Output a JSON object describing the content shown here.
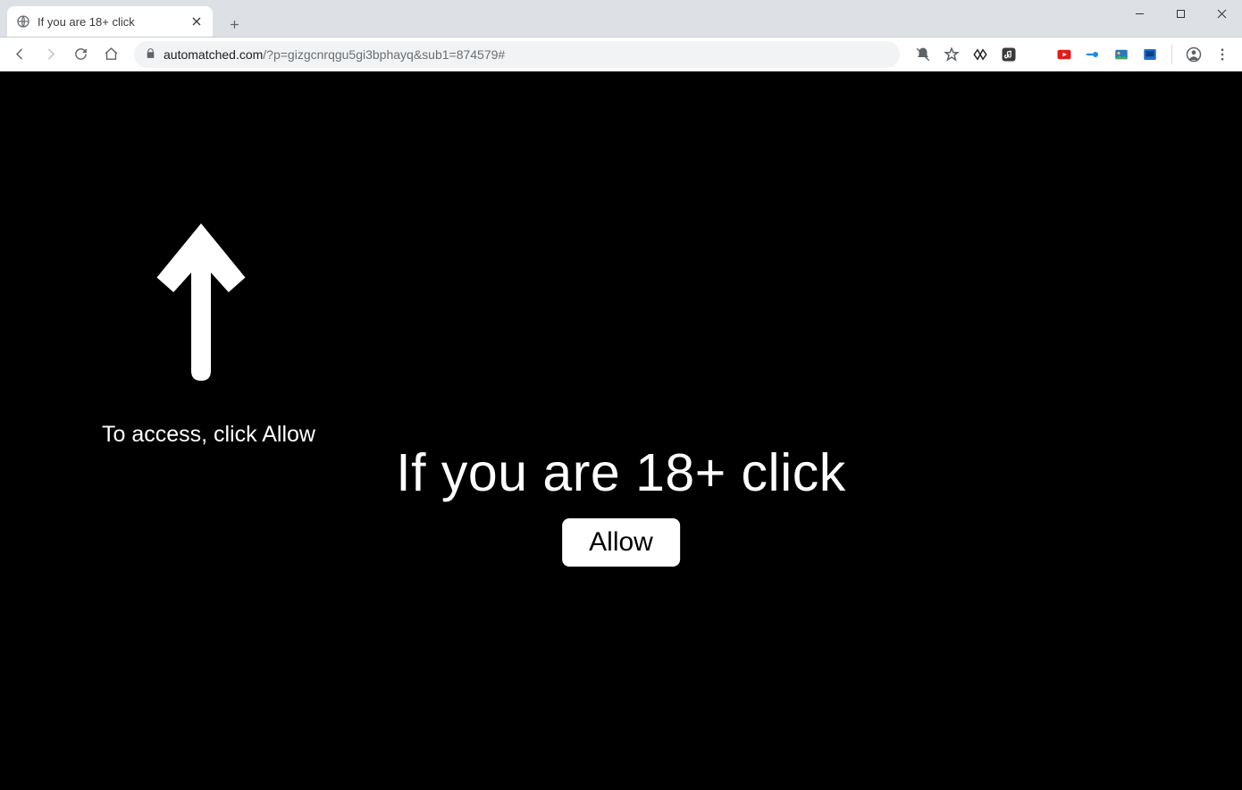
{
  "window": {
    "tab_title": "If you are 18+ click"
  },
  "toolbar": {
    "url_domain": "automatched.com",
    "url_path": "/?p=gizgcnrqgu5gi3bphayq&sub1=874579#"
  },
  "page": {
    "access_text": "To access, click Allow",
    "headline": "If you are 18+ click",
    "allow_label": "Allow"
  }
}
